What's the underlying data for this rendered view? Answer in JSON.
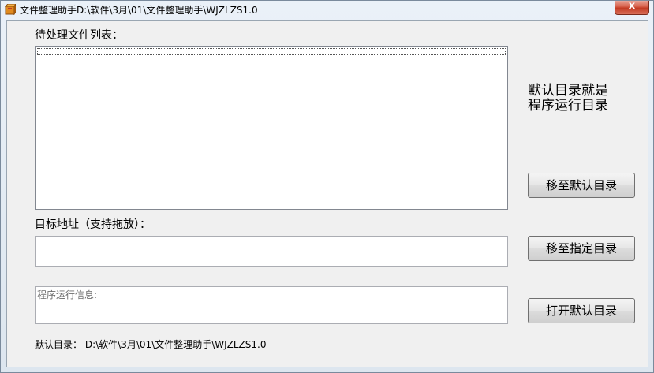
{
  "window": {
    "title": "文件整理助手D:\\软件\\3月\\01\\文件整理助手\\WJZLZS1.0",
    "close_glyph": "x",
    "app_icon": "package-icon"
  },
  "file_list": {
    "label": "待处理文件列表：",
    "items": []
  },
  "side_note": {
    "line1": "默认目录就是",
    "line2": "程序运行目录"
  },
  "target": {
    "label": "目标地址（支持拖放）：",
    "value": ""
  },
  "info": {
    "placeholder": "程序运行信息:"
  },
  "buttons": {
    "move_default": "移至默认目录",
    "move_specified": "移至指定目录",
    "open_default": "打开默认目录"
  },
  "footer": {
    "label": "默认目录：",
    "path": "D:\\软件\\3月\\01\\文件整理助手\\WJZLZS1.0"
  }
}
